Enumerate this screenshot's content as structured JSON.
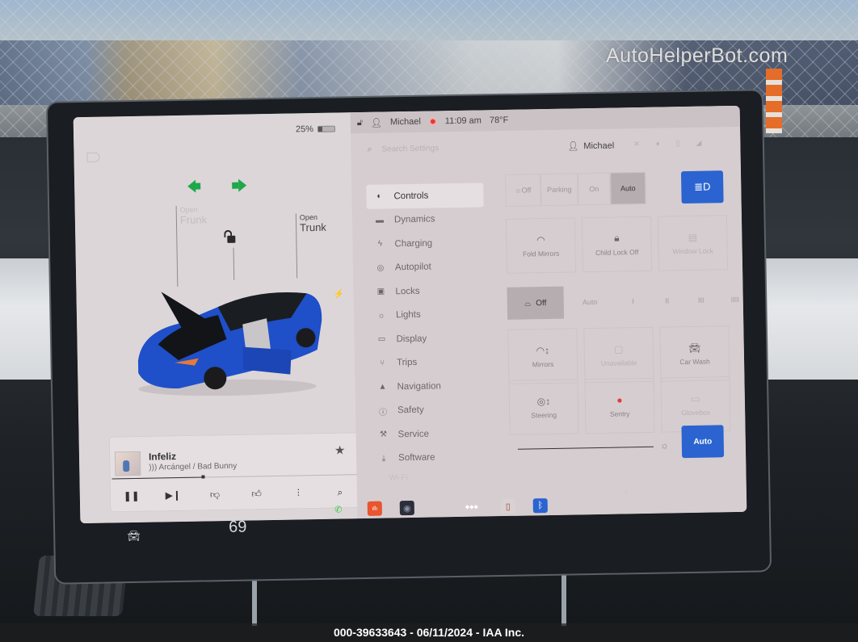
{
  "watermark": "AutoHelperBot.com",
  "footer": "000-39633643 - 06/11/2024 - IAA Inc.",
  "car_panel": {
    "battery_percent_label": "25%",
    "battery_level": 0.25,
    "frunk": {
      "action": "Open",
      "label": "Frunk"
    },
    "trunk": {
      "action": "Open",
      "label": "Trunk"
    },
    "lock_state": "unlocked",
    "charge_icon": "⚡"
  },
  "media": {
    "title": "Infeliz",
    "artist": "Arcángel / Bad Bunny",
    "progress": 0.37,
    "favorite_icon": "★",
    "controls": [
      {
        "name": "pause-button",
        "icon": "❚❚"
      },
      {
        "name": "next-track-button",
        "icon": "▶❙"
      },
      {
        "name": "thumbs-down-button",
        "icon": "👎︎"
      },
      {
        "name": "thumbs-up-button",
        "icon": "👍︎"
      },
      {
        "name": "equalizer-button",
        "icon": "⫶"
      },
      {
        "name": "media-search-button",
        "icon": "⌕"
      }
    ]
  },
  "status_bar": {
    "user": "Michael",
    "time": "11:09 am",
    "temperature": "78°F"
  },
  "settings": {
    "search_placeholder": "Search Settings",
    "user": "Michael",
    "nav": [
      {
        "label": "Controls",
        "icon": "◐",
        "active": true
      },
      {
        "label": "Dynamics",
        "icon": "▬"
      },
      {
        "label": "Charging",
        "icon": "ϟ"
      },
      {
        "label": "Autopilot",
        "icon": "◎"
      },
      {
        "label": "Locks",
        "icon": "▣"
      },
      {
        "label": "Lights",
        "icon": "☼"
      },
      {
        "label": "Display",
        "icon": "▭"
      },
      {
        "label": "Trips",
        "icon": "⑂"
      },
      {
        "label": "Navigation",
        "icon": "▲"
      },
      {
        "label": "Safety",
        "icon": "ⓘ"
      },
      {
        "label": "Service",
        "icon": "⚒"
      },
      {
        "label": "Software",
        "icon": "⤓"
      }
    ],
    "nav_faded": "Wi-Fi",
    "lights": {
      "options": [
        "Off",
        "Parking",
        "On",
        "Auto"
      ],
      "selected": "Auto",
      "headlight_button": "≣D"
    },
    "tiles_row1": [
      {
        "label": "Fold Mirrors",
        "icon": "◠"
      },
      {
        "label": "Child Lock Off",
        "icon": "🔒︎"
      },
      {
        "label": "Window Lock",
        "icon": "▤",
        "faded": true
      }
    ],
    "wipers": {
      "options": [
        "Off",
        "Auto",
        "I",
        "II",
        "III",
        "IIII"
      ],
      "selected": "Off"
    },
    "tiles_row2": [
      {
        "label": "Mirrors",
        "icon": "◠↕"
      },
      {
        "label": "Unavailable",
        "icon": "▢",
        "faded": true
      },
      {
        "label": "Car Wash",
        "icon": "🚘︎"
      }
    ],
    "tiles_row3": [
      {
        "label": "Steering",
        "icon": "◎↕"
      },
      {
        "label": "Sentry",
        "icon": "●",
        "icon_color": "#e23b3b"
      },
      {
        "label": "Glovebox",
        "icon": "▭",
        "faded": true
      }
    ],
    "brightness_auto_label": "Auto"
  },
  "dock": {
    "temperature": "69",
    "apps": [
      {
        "name": "phone-icon",
        "glyph": "✆",
        "bg": "transparent",
        "color": "#2ecc40"
      },
      {
        "name": "voice-recorder-icon",
        "glyph": "ıllı",
        "bg": "#e8552f",
        "color": "#ffffff"
      },
      {
        "name": "camera-icon",
        "glyph": "◉",
        "bg": "#2c2f3a",
        "color": "#8a8fa0"
      },
      {
        "name": "more-apps-icon",
        "glyph": "•••",
        "bg": "transparent",
        "color": "#c9cdd0"
      },
      {
        "name": "tidal-icon",
        "glyph": "◆◆◆",
        "bg": "transparent",
        "color": "#ffffff"
      },
      {
        "name": "calendar-icon",
        "glyph": "▯",
        "bg": "#d8d2d2",
        "color": "#b34040"
      },
      {
        "name": "bluetooth-icon",
        "glyph": "ᛒ",
        "bg": "#2b64d0",
        "color": "#ffffff"
      }
    ]
  }
}
